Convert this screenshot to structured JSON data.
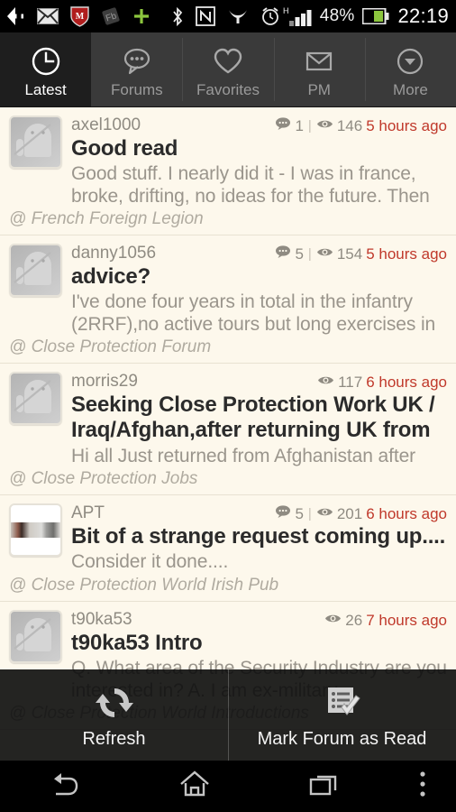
{
  "statusbar": {
    "icons": [
      "back-arrow-badge-icon",
      "mail-icon",
      "mcafee-shield-icon",
      "tag-icon",
      "plus-icon",
      "bluetooth-icon",
      "nfc-icon",
      "tumblr-icon",
      "alarm-clock-icon",
      "signal-bars-icon"
    ],
    "network_type": "H",
    "battery_percent": "48%",
    "clock": "22:19"
  },
  "tabs": [
    {
      "label": "Latest",
      "icon": "clock-icon",
      "active": true
    },
    {
      "label": "Forums",
      "icon": "speech-bubble-icon",
      "active": false
    },
    {
      "label": "Favorites",
      "icon": "heart-icon",
      "active": false
    },
    {
      "label": "PM",
      "icon": "envelope-icon",
      "active": false
    },
    {
      "label": "More",
      "icon": "chevron-down-circle-icon",
      "active": false
    }
  ],
  "posts": [
    {
      "author": "axel1000",
      "avatar": "android-placeholder",
      "replies": "1",
      "views": "146",
      "time": "5 hours ago",
      "title": "Good read",
      "snippet": "Good stuff. I nearly did it - I was in france, broke, drifting, no ideas for the future. Then",
      "forum": "@ French Foreign Legion"
    },
    {
      "author": "danny1056",
      "avatar": "android-placeholder",
      "replies": "5",
      "views": "154",
      "time": "5 hours ago",
      "title": "advice?",
      "snippet": "I've done four years in total in the infantry (2RRF),no active tours but long exercises in",
      "forum": "@ Close Protection Forum"
    },
    {
      "author": "morris29",
      "avatar": "android-placeholder",
      "replies": "",
      "views": "117",
      "time": "6 hours ago",
      "title": "Seeking Close Protection Work UK / Iraq/Afghan,after returning UK from",
      "snippet": "Hi all Just returned from Afghanistan after",
      "forum": "@ Close Protection Jobs"
    },
    {
      "author": "APT",
      "avatar": "photo-thumbnail",
      "replies": "5",
      "views": "201",
      "time": "6 hours ago",
      "title": "Bit of a strange request coming up....",
      "snippet": "Consider it done....",
      "forum": "@ Close Protection World Irish Pub"
    },
    {
      "author": "t90ka53",
      "avatar": "android-placeholder",
      "replies": "",
      "views": "26",
      "time": "7 hours ago",
      "title": "t90ka53 Intro",
      "snippet": "Q. What area of the Security Industry are you interested in? A. I am ex-military,",
      "forum": "@ Close Protection World Introductions"
    }
  ],
  "overlay_menu": [
    {
      "label": "Refresh",
      "icon": "refresh-icon"
    },
    {
      "label": "Mark Forum as Read",
      "icon": "mark-read-icon"
    }
  ],
  "navbar": [
    {
      "name": "back",
      "icon": "back-icon"
    },
    {
      "name": "home",
      "icon": "home-icon"
    },
    {
      "name": "recents",
      "icon": "recents-icon"
    },
    {
      "name": "menu",
      "icon": "overflow-menu-icon"
    }
  ],
  "colors": {
    "list_background": "#fdf8ec",
    "timestamp": "#c0392b",
    "tab_active_bg": "#1e1e1e",
    "tab_bar_bg": "#3a3a3a",
    "battery_green": "#8cc63e"
  }
}
